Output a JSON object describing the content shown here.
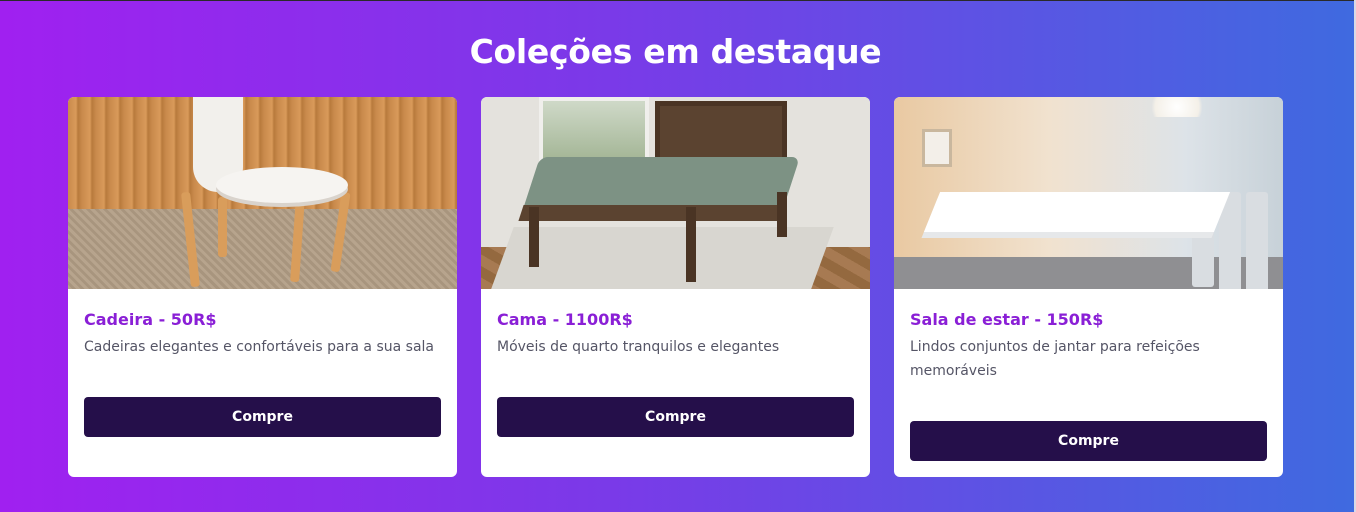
{
  "section": {
    "title": "Coleções em destaque"
  },
  "products": [
    {
      "name": "Cadeira - 50R$",
      "description": "Cadeiras elegantes e confortáveis para a sua sala",
      "button_label": "Compre"
    },
    {
      "name": "Cama - 1100R$",
      "description": "Móveis de quarto tranquilos e elegantes",
      "button_label": "Compre"
    },
    {
      "name": "Sala de estar - 150R$",
      "description": "Lindos conjuntos de jantar para refeições memoráveis",
      "button_label": "Compre"
    }
  ],
  "colors": {
    "product_name": "#8a1fd6",
    "button_bg": "#250f4a",
    "gradient_start": "#a020f0",
    "gradient_end": "#3f6ae0"
  }
}
